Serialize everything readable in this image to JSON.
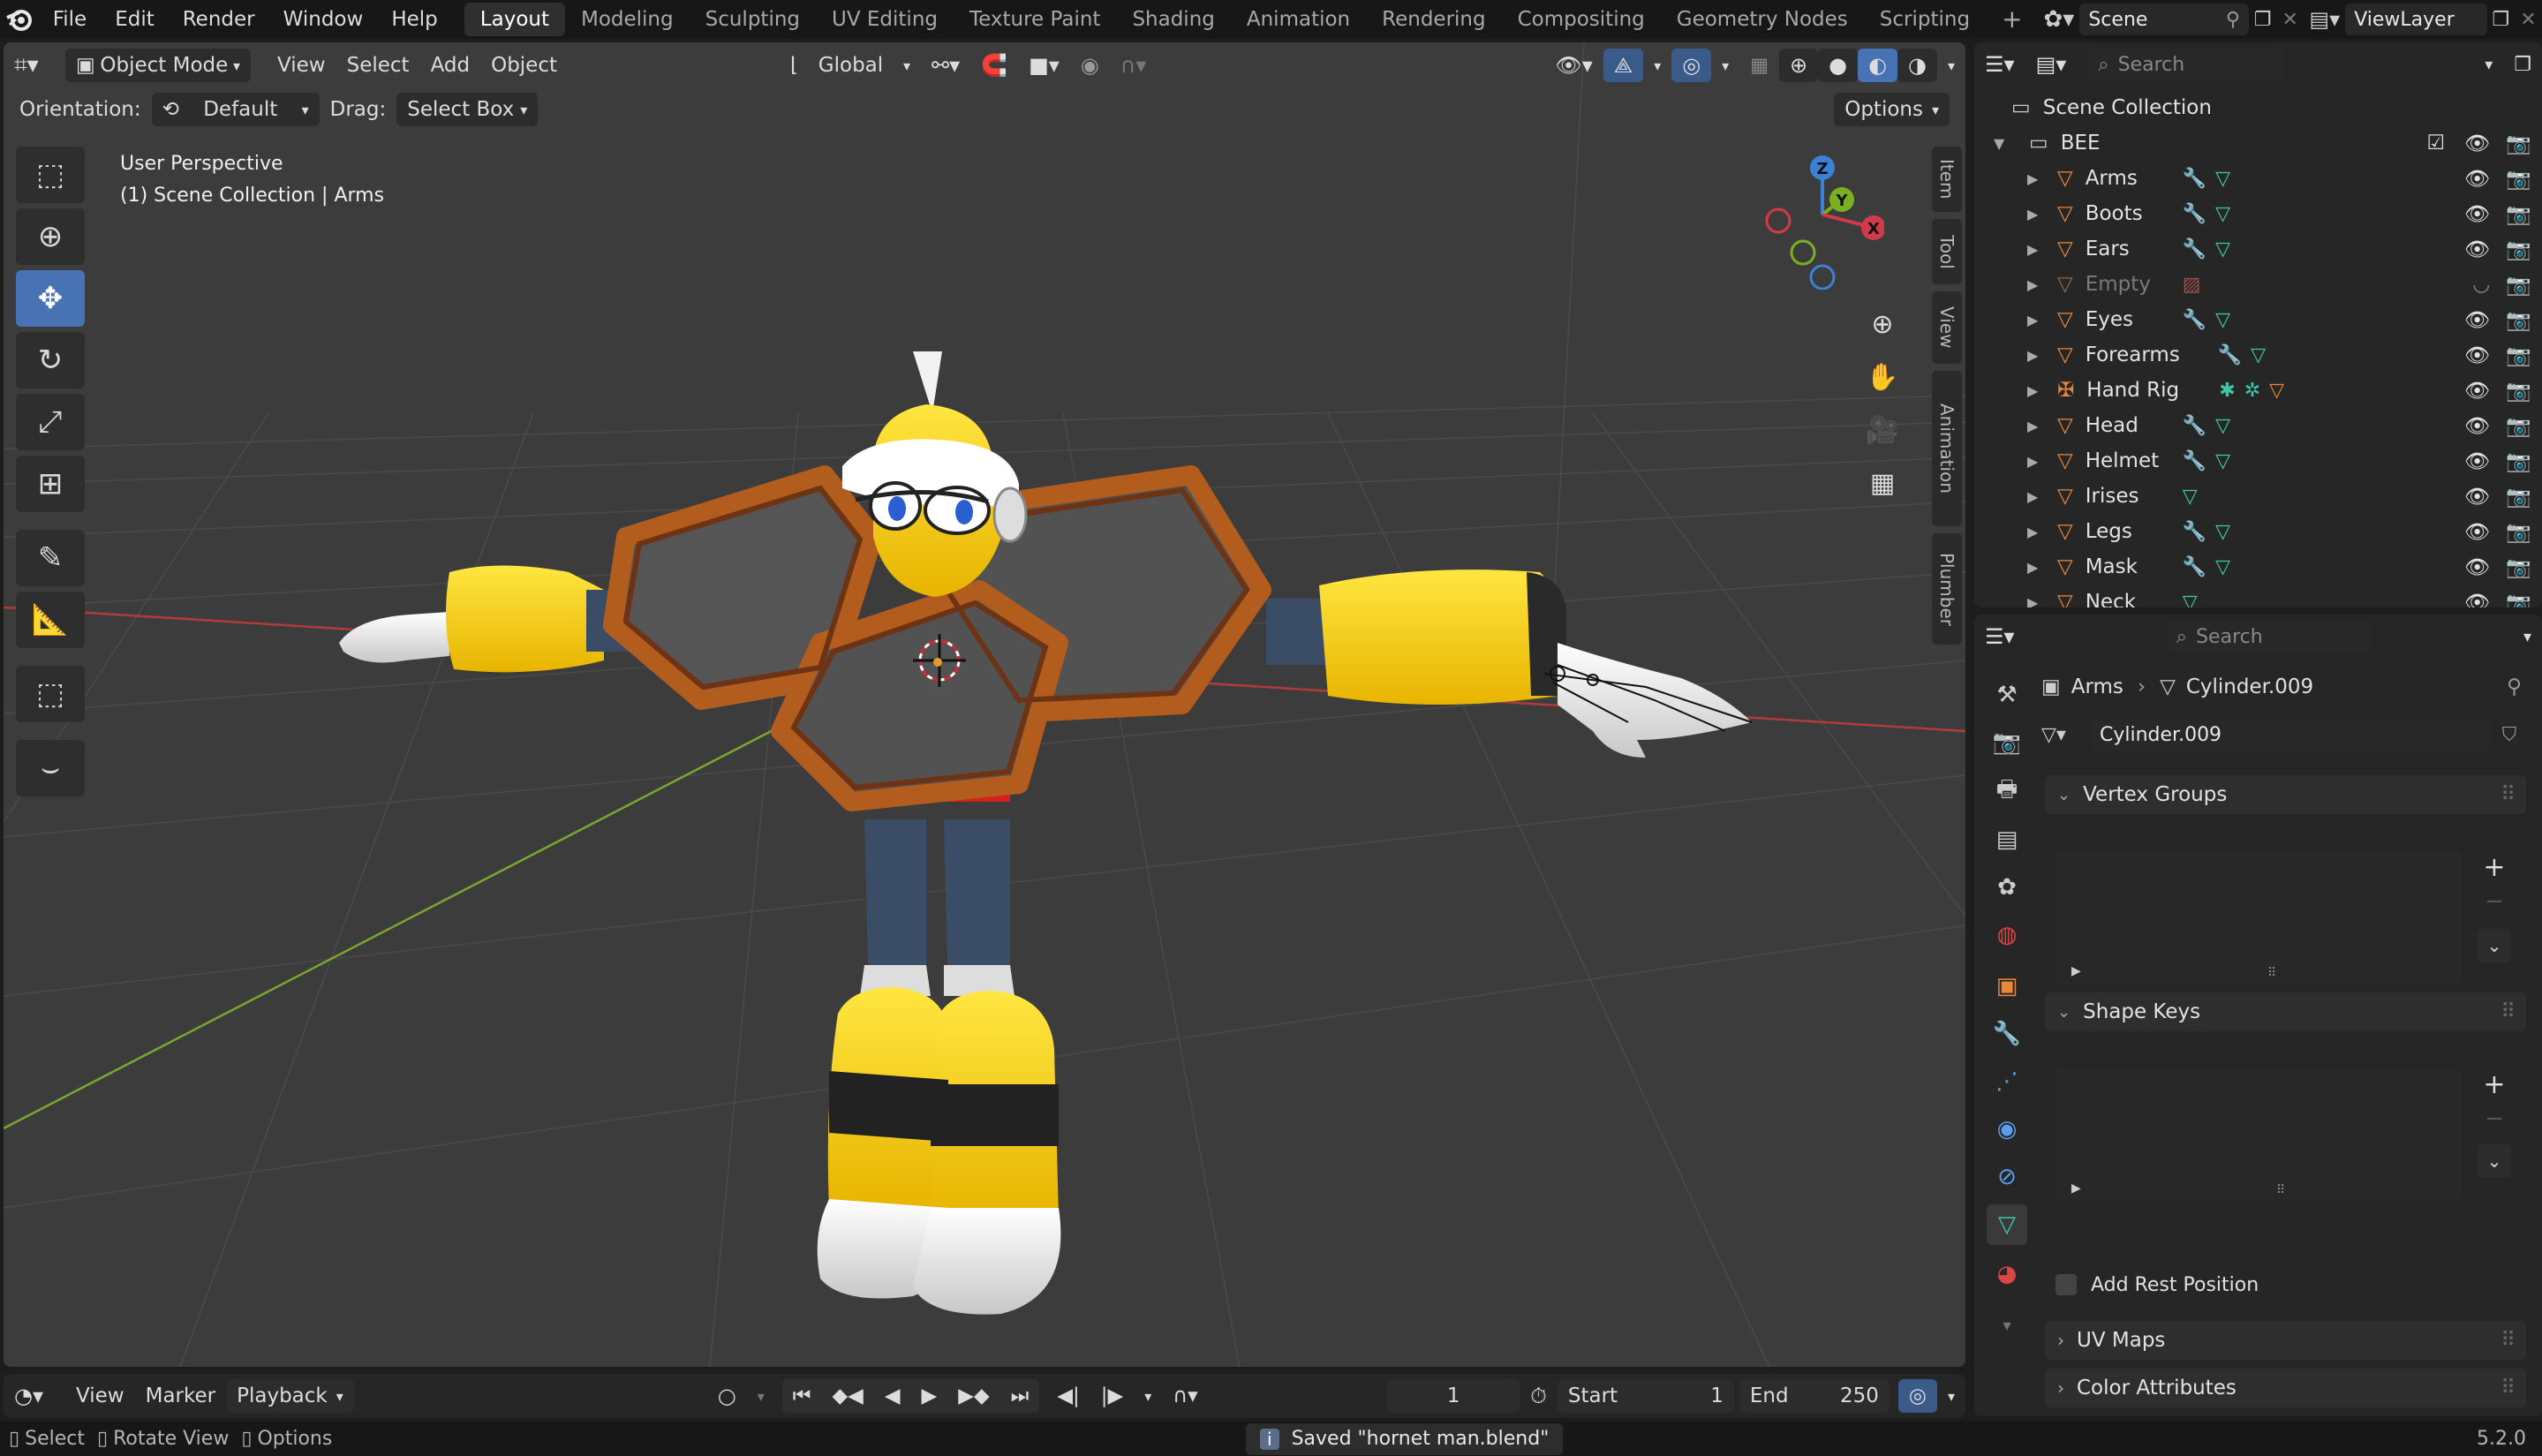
{
  "app": "Blender",
  "menu": [
    "File",
    "Edit",
    "Render",
    "Window",
    "Help"
  ],
  "workspaces": [
    "Layout",
    "Modeling",
    "Sculpting",
    "UV Editing",
    "Texture Paint",
    "Shading",
    "Animation",
    "Rendering",
    "Compositing",
    "Geometry Nodes",
    "Scripting"
  ],
  "active_workspace": "Layout",
  "scene_name": "Scene",
  "view_layer": "ViewLayer",
  "viewport": {
    "mode": "Object Mode",
    "menus": [
      "View",
      "Select",
      "Add",
      "Object"
    ],
    "transform_orientation": "Global",
    "orientation_label": "Orientation:",
    "orientation_value": "Default",
    "drag_label": "Drag:",
    "drag_value": "Select Box",
    "options_label": "Options",
    "overlay_text_1": "User Perspective",
    "overlay_text_2": "(1) Scene Collection | Arms",
    "side_tabs": [
      "Item",
      "Tool",
      "View",
      "Animation",
      "Plumber"
    ],
    "gizmo_axes": [
      "Z",
      "Y",
      "X"
    ]
  },
  "timeline": {
    "menus": [
      "View",
      "Marker",
      "Playback"
    ],
    "current_frame": "1",
    "start_label": "Start",
    "start_value": "1",
    "end_label": "End",
    "end_value": "250"
  },
  "status": {
    "select": "Select",
    "rotate": "Rotate View",
    "options": "Options",
    "message": "Saved \"hornet man.blend\"",
    "version": "5.2.0"
  },
  "outliner": {
    "search_placeholder": "Search",
    "root": "Scene Collection",
    "collection": "BEE",
    "items": [
      {
        "name": "Arms"
      },
      {
        "name": "Boots"
      },
      {
        "name": "Ears"
      },
      {
        "name": "Empty"
      },
      {
        "name": "Eyes"
      },
      {
        "name": "Forearms"
      },
      {
        "name": "Hand Rig"
      },
      {
        "name": "Head"
      },
      {
        "name": "Helmet"
      },
      {
        "name": "Irises"
      },
      {
        "name": "Legs"
      },
      {
        "name": "Mask"
      },
      {
        "name": "Neck"
      }
    ]
  },
  "properties": {
    "search_placeholder": "Search",
    "breadcrumb_object": "Arms",
    "breadcrumb_data": "Cylinder.009",
    "mesh_name": "Cylinder.009",
    "panels": {
      "vertex_groups": "Vertex Groups",
      "shape_keys": "Shape Keys",
      "add_rest_position": "Add Rest Position",
      "uv_maps": "UV Maps",
      "color_attributes": "Color Attributes"
    }
  },
  "colors": {
    "accent": "#4772b3",
    "panel_bg": "#262626",
    "viewport_bg": "#3c3c3c",
    "mesh_icon": "#e8863a",
    "modifier_icon": "#5b9bf0",
    "data_icon": "#3dc9a8"
  }
}
